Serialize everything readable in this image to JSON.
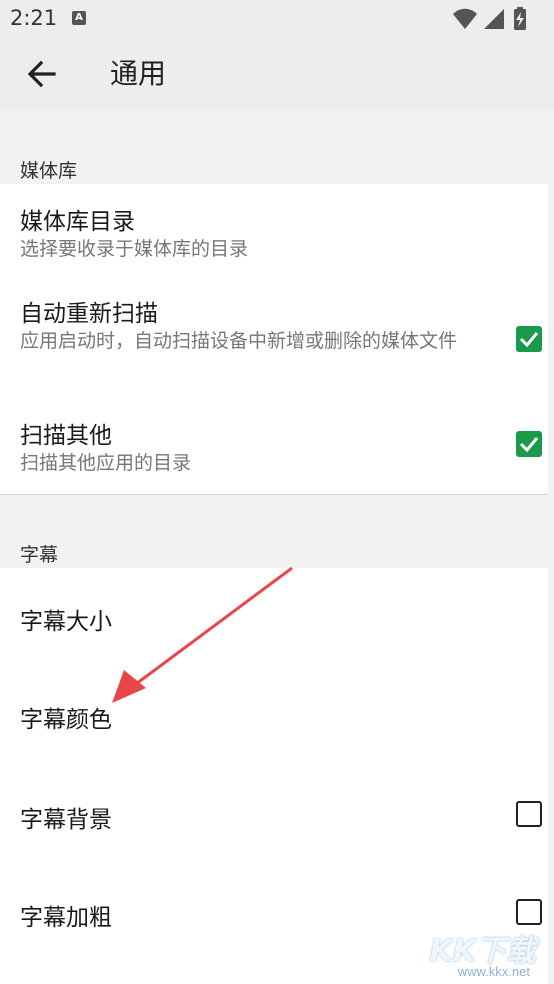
{
  "status_bar": {
    "time": "2:21",
    "notification_icon": "A",
    "icons": [
      "wifi-icon",
      "signal-icon",
      "battery-charging-icon"
    ]
  },
  "toolbar": {
    "title": "通用",
    "back_icon": "arrow-left-icon"
  },
  "sections": {
    "media": {
      "header": "媒体库",
      "items": [
        {
          "title": "媒体库目录",
          "summary": "选择要收录于媒体库的目录"
        },
        {
          "title": "自动重新扫描",
          "summary": "应用启动时，自动扫描设备中新增或删除的媒体文件",
          "checked": true
        },
        {
          "title": "扫描其他",
          "summary": "扫描其他应用的目录",
          "checked": true
        }
      ]
    },
    "subtitle": {
      "header": "字幕",
      "items": [
        {
          "title": "字幕大小"
        },
        {
          "title": "字幕颜色"
        },
        {
          "title": "字幕背景",
          "checked": false
        },
        {
          "title": "字幕加粗",
          "checked": false
        }
      ]
    }
  },
  "watermark": {
    "brand": "KK下载",
    "url": "www.kkx.net"
  },
  "colors": {
    "accent": "#1a9b4a",
    "annotation_arrow": "#e8474a"
  }
}
